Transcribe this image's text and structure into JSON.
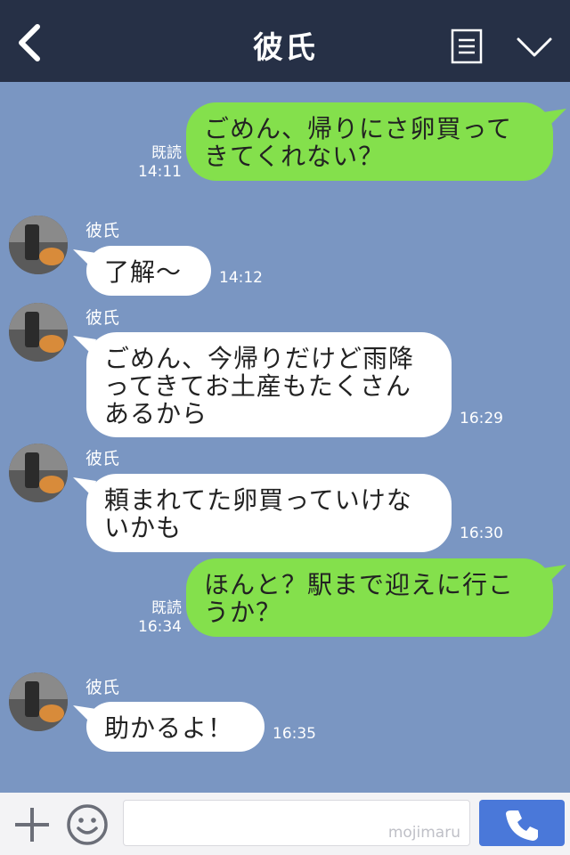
{
  "header": {
    "title": "彼氏"
  },
  "messages": [
    {
      "from": "me",
      "text": "ごめん、帰りにさ卵買ってきてくれない？",
      "lines": [
        "ごめん、帰りにさ卵買って",
        "きてくれない？"
      ],
      "read": "既読",
      "time": "14:11"
    },
    {
      "from": "them",
      "name": "彼氏",
      "lines": [
        "了解〜"
      ],
      "time": "14:12"
    },
    {
      "from": "them",
      "name": "彼氏",
      "lines": [
        "ごめん、今帰りだけど雨降",
        "ってきてお土産もたくさん",
        "あるから"
      ],
      "time": "16:29"
    },
    {
      "from": "them",
      "name": "彼氏",
      "lines": [
        "頼まれてた卵買っていけな",
        "いかも"
      ],
      "time": "16:30"
    },
    {
      "from": "me",
      "lines": [
        "ほんと？駅まで迎えに行こ",
        "うか？"
      ],
      "read": "既読",
      "time": "16:34"
    },
    {
      "from": "them",
      "name": "彼氏",
      "lines": [
        "助かるよ！"
      ],
      "time": "16:35"
    }
  ],
  "input": {
    "value": "",
    "watermark": "mojimaru"
  },
  "colors": {
    "header": "#263046",
    "background": "#7a96c2",
    "my_bubble": "#84e04c",
    "their_bubble": "#ffffff",
    "call_button": "#4a78d9"
  },
  "icons": {
    "back": "chevron-left-icon",
    "menu": "notes-icon",
    "collapse": "chevron-down-icon",
    "add": "plus-icon",
    "sticker": "smiley-icon",
    "call": "phone-icon"
  }
}
